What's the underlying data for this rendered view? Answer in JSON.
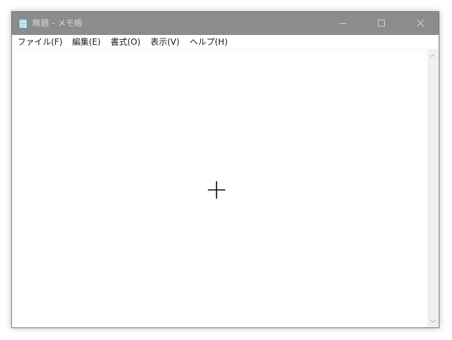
{
  "window": {
    "title": "無題 - メモ帳",
    "app_icon": "notepad-icon"
  },
  "caption_buttons": {
    "minimize_icon": "minimize-icon",
    "maximize_icon": "maximize-icon",
    "close_icon": "close-icon"
  },
  "menu": {
    "items": [
      {
        "label": "ファイル(F)"
      },
      {
        "label": "編集(E)"
      },
      {
        "label": "書式(O)"
      },
      {
        "label": "表示(V)"
      },
      {
        "label": "ヘルプ(H)"
      }
    ]
  },
  "editor": {
    "content": "",
    "cursor_icon": "crosshair-cursor-icon"
  },
  "scrollbar": {
    "up_icon": "chevron-up-icon",
    "down_icon": "chevron-down-icon"
  },
  "colors": {
    "titlebar_inactive": "#8c8c8c",
    "title_text": "#d6d6d6",
    "scrollbar_track": "#f0f0f0"
  }
}
